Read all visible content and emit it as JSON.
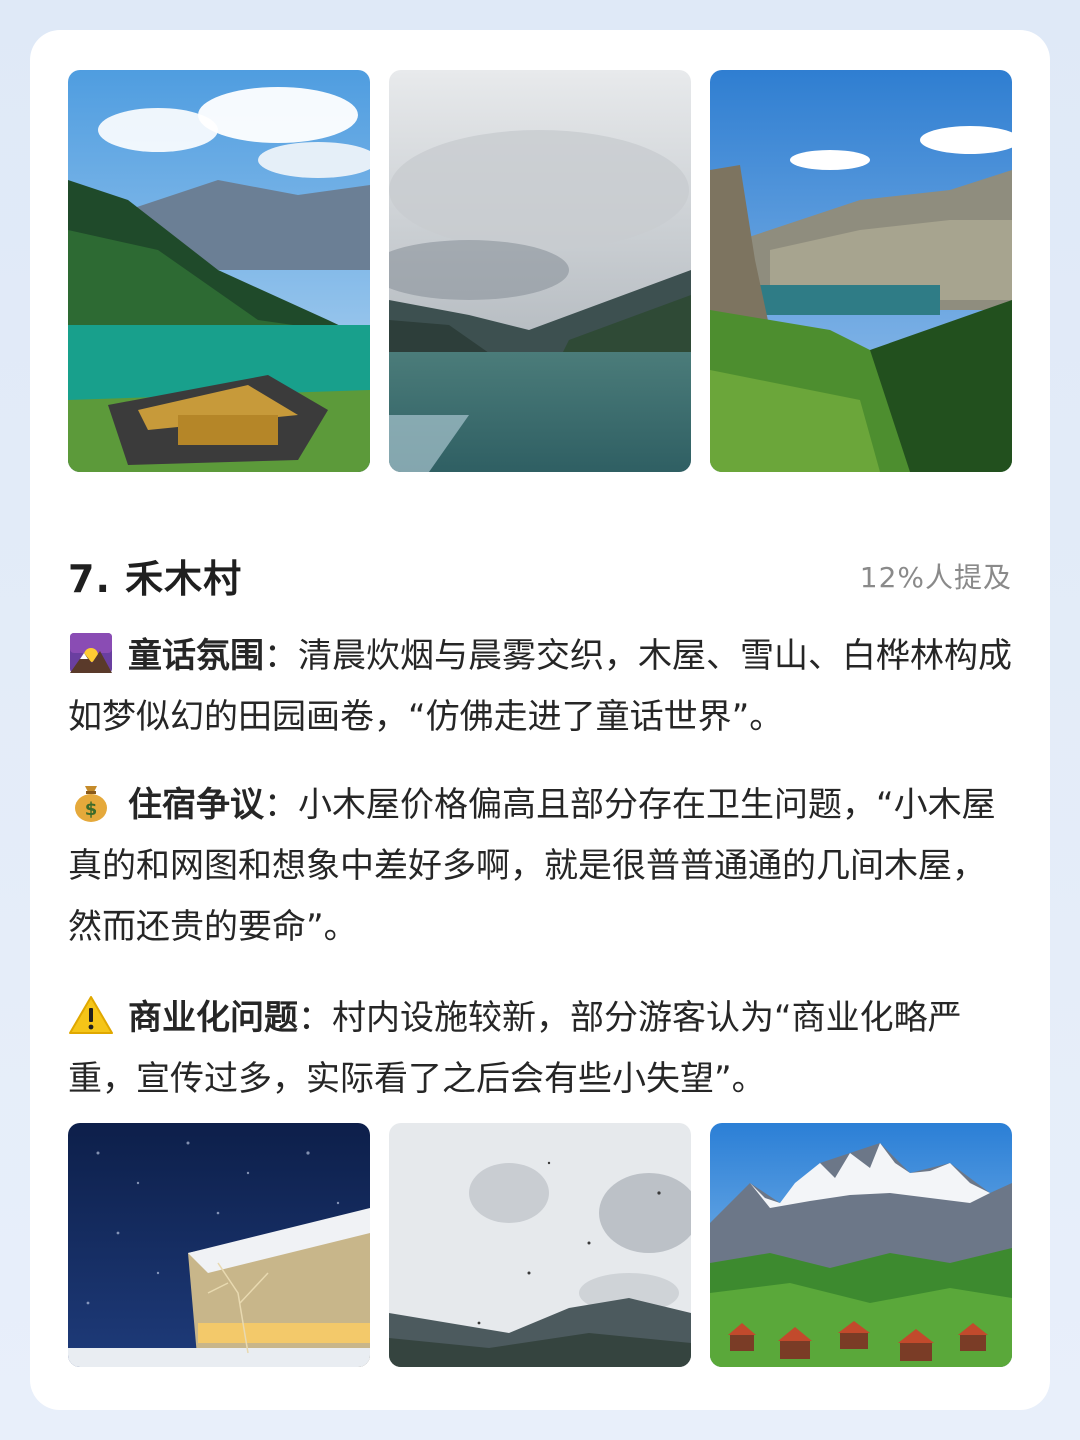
{
  "section": {
    "title": "7. 禾木村",
    "mention": "12%人提及"
  },
  "paragraphs": [
    {
      "icon": "sunrise-over-mountains-icon",
      "label": "童话氛围",
      "colon": "：",
      "text": "清晨炊烟与晨雾交织，木屋、雪山、白桦林构成如梦似幻的田园画卷，“仿佛走进了童话世界”。"
    },
    {
      "icon": "money-bag-icon",
      "label": "住宿争议",
      "colon": "：",
      "text": "小木屋价格偏高且部分存在卫生问题，“小木屋真的和网图和想象中差好多啊，就是很普普通通的几间木屋，然而还贵的要命”。"
    },
    {
      "icon": "warning-icon",
      "label": "商业化问题",
      "colon": "：",
      "text": "村内设施较新，部分游客认为“商业化略严重，宣传过多，实际看了之后会有些小失望”。"
    }
  ],
  "photos_top": [
    {
      "name": "lake-temple-photo"
    },
    {
      "name": "cloudy-lake-photo"
    },
    {
      "name": "mountain-lake-overlook-photo"
    }
  ],
  "photos_bottom": [
    {
      "name": "snowy-night-cabin-photo"
    },
    {
      "name": "overcast-hills-photo"
    },
    {
      "name": "snowcapped-village-photo"
    }
  ],
  "colors": {
    "background": "#e3ecf8",
    "card": "#ffffff",
    "text": "#262626",
    "muted": "#8a8a8a"
  }
}
